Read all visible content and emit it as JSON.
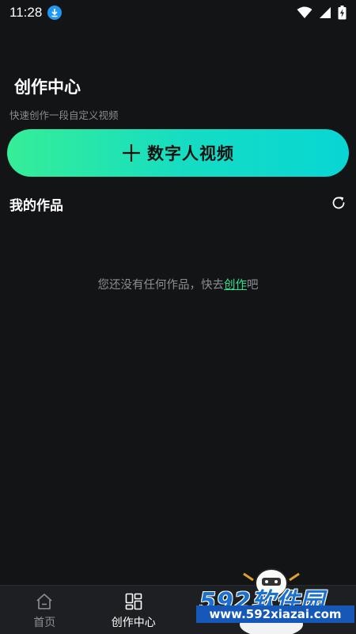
{
  "status_bar": {
    "time": "11:28",
    "icons": [
      "download-notification-icon",
      "wifi-icon",
      "signal-icon",
      "battery-charging-icon"
    ]
  },
  "header": {
    "title": "创作中心",
    "subtitle": "快速创作一段自定义视频"
  },
  "create_button": {
    "label": "数字人视频",
    "icon": "plus-icon"
  },
  "works": {
    "title": "我的作品",
    "refresh_icon": "refresh-icon",
    "empty_prefix": "您还没有任何作品，快去",
    "empty_link": "创作",
    "empty_suffix": "吧"
  },
  "tab_bar": {
    "tabs": [
      {
        "label": "首页",
        "icon": "home-icon",
        "active": false
      },
      {
        "label": "创作中心",
        "icon": "grid-icon",
        "active": true
      }
    ]
  },
  "watermark": {
    "logo": "592软件园",
    "url": "www.592xiazai.com"
  },
  "colors": {
    "background": "#131416",
    "accent_start": "#35ee98",
    "accent_end": "#08d6d4",
    "link": "#2fe08f"
  }
}
